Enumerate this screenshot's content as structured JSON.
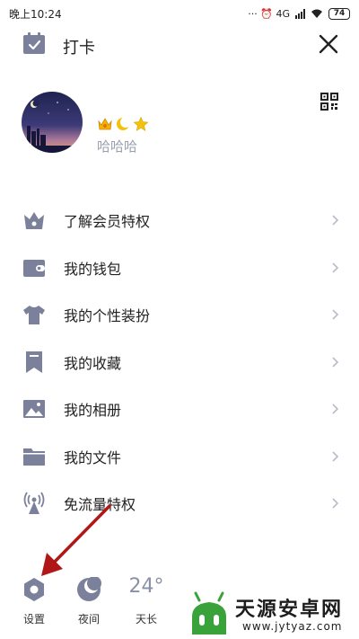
{
  "status_bar": {
    "time": "晚上10:24",
    "right_text": "··· ⏰ 4G",
    "battery": "74"
  },
  "header": {
    "checkin_label": "打卡",
    "close_icon": "close-icon",
    "qr_icon": "qr-code-icon"
  },
  "profile": {
    "username": "哈哈哈",
    "badges": [
      "crown",
      "moon",
      "star"
    ]
  },
  "menu": {
    "items": [
      {
        "label": "了解会员特权",
        "icon": "vip-crown-icon"
      },
      {
        "label": "我的钱包",
        "icon": "wallet-icon"
      },
      {
        "label": "我的个性装扮",
        "icon": "shirt-icon"
      },
      {
        "label": "我的收藏",
        "icon": "bookmark-icon"
      },
      {
        "label": "我的相册",
        "icon": "photo-album-icon"
      },
      {
        "label": "我的文件",
        "icon": "folder-icon"
      },
      {
        "label": "免流量特权",
        "icon": "signal-tower-icon"
      }
    ]
  },
  "bottom_bar": {
    "settings_label": "设置",
    "night_label": "夜间",
    "weather_label": "天长",
    "temperature": "24°"
  },
  "watermark": {
    "title": "天源安卓网",
    "url": "www.jytyaz.com"
  },
  "colors": {
    "icon": "#7b819b",
    "arrow": "#b01818",
    "watermark_green": "#3aa23a"
  }
}
